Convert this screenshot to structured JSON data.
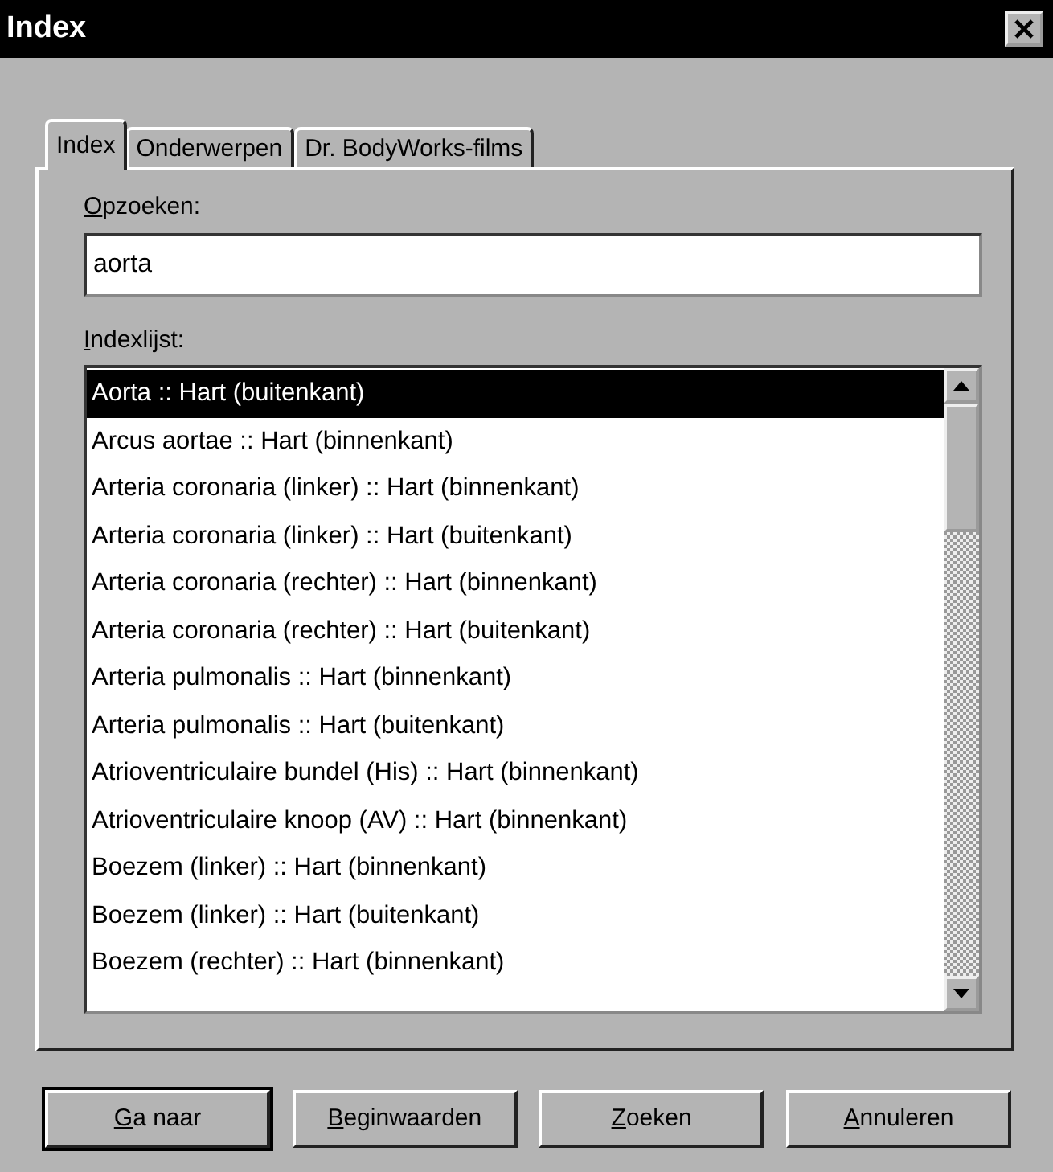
{
  "window": {
    "title": "Index"
  },
  "tabs": [
    {
      "label": "Index",
      "selected": true
    },
    {
      "label": "Onderwerpen",
      "selected": false
    },
    {
      "label": "Dr. BodyWorks-films",
      "selected": false
    }
  ],
  "search": {
    "label": "Opzoeken:",
    "value": "aorta"
  },
  "index_list": {
    "label": "Indexlijst:",
    "items": [
      {
        "text": "Aorta :: Hart (buitenkant)",
        "selected": true
      },
      {
        "text": "Arcus aortae :: Hart (binnenkant)",
        "selected": false
      },
      {
        "text": "Arteria coronaria (linker) :: Hart (binnenkant)",
        "selected": false
      },
      {
        "text": "Arteria coronaria (linker) :: Hart (buitenkant)",
        "selected": false
      },
      {
        "text": "Arteria coronaria (rechter) :: Hart (binnenkant)",
        "selected": false
      },
      {
        "text": "Arteria coronaria (rechter) :: Hart (buitenkant)",
        "selected": false
      },
      {
        "text": "Arteria pulmonalis :: Hart (binnenkant)",
        "selected": false
      },
      {
        "text": "Arteria pulmonalis :: Hart (buitenkant)",
        "selected": false
      },
      {
        "text": "Atrioventriculaire bundel (His) :: Hart (binnenkant)",
        "selected": false
      },
      {
        "text": "Atrioventriculaire knoop (AV) :: Hart (binnenkant)",
        "selected": false
      },
      {
        "text": "Boezem (linker) :: Hart (binnenkant)",
        "selected": false
      },
      {
        "text": "Boezem (linker) :: Hart (buitenkant)",
        "selected": false
      },
      {
        "text": "Boezem (rechter) :: Hart (binnenkant)",
        "selected": false
      }
    ]
  },
  "buttons": [
    "Ga naar",
    "Beginwaarden",
    "Zoeken",
    "Annuleren"
  ]
}
